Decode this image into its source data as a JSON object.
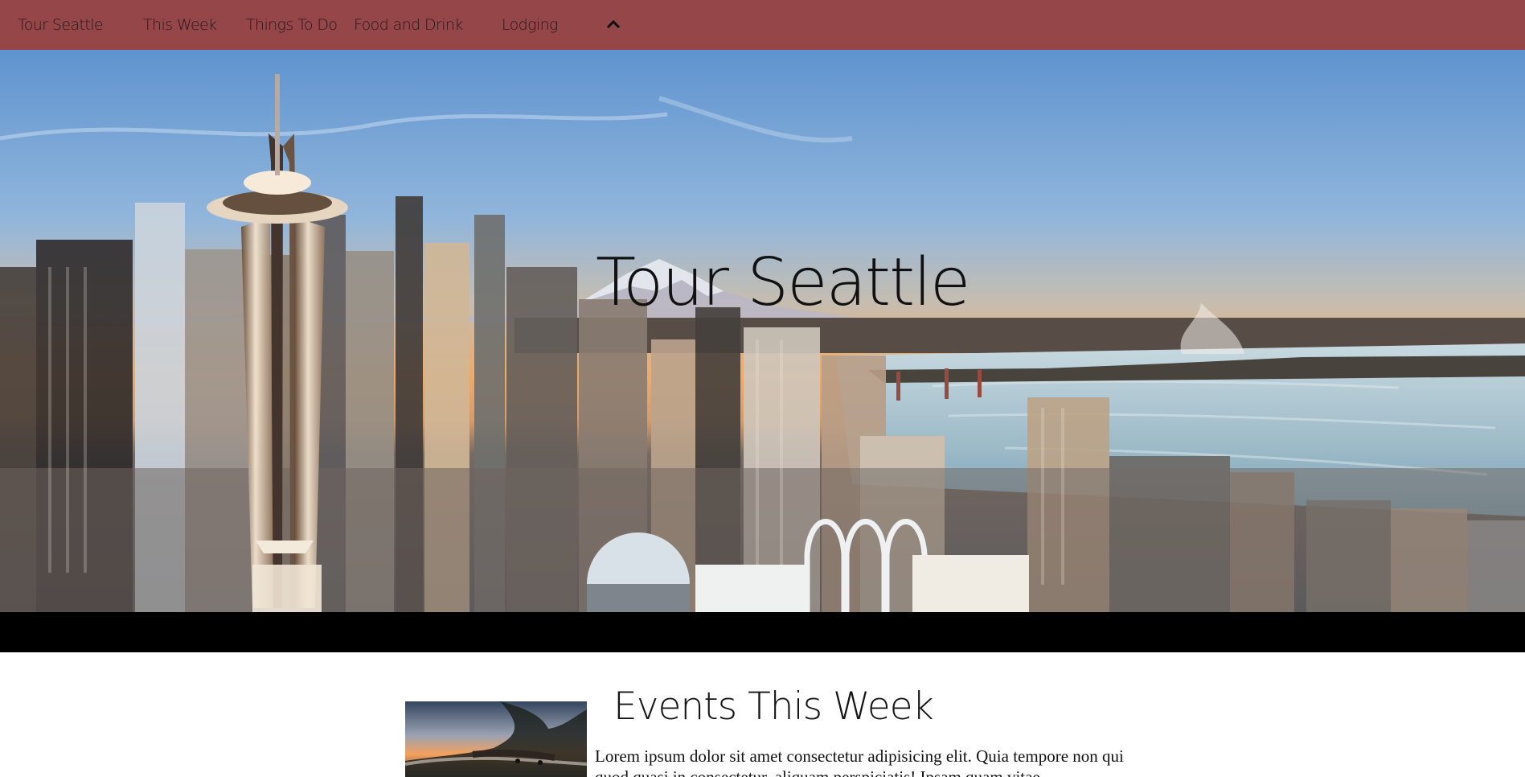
{
  "nav": {
    "brand": "Tour Seattle",
    "links": [
      "This Week",
      "Things To Do",
      "Food and Drink",
      "Lodging"
    ],
    "collapse_icon": "chevron-up-icon"
  },
  "hero": {
    "title": "Tour Seattle",
    "image": "seattle-skyline-sunset"
  },
  "events": {
    "title": "Events This Week",
    "items": [
      {
        "image": "beach-sunset-thumbnail",
        "text": "Lorem ipsum dolor sit amet consectetur adipisicing elit. Quia tempore non qui quod quasi in consectetur, aliquam perspiciatis! Ipsam quam vitae"
      }
    ]
  },
  "colors": {
    "nav_background": "#944649",
    "band_background": "#000000",
    "page_background": "#ffffff"
  }
}
